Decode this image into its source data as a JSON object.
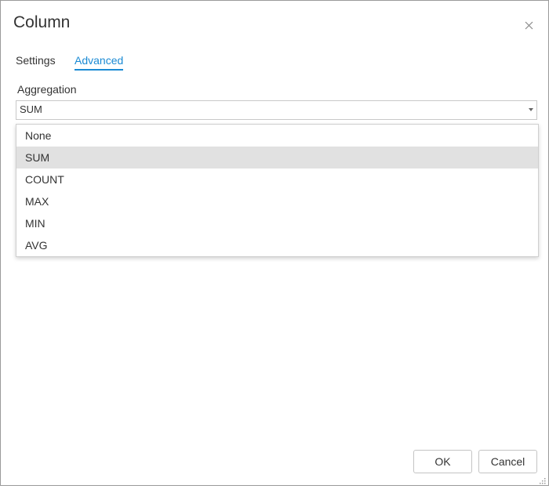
{
  "dialog": {
    "title": "Column",
    "close_icon": "close-icon"
  },
  "tabs": [
    {
      "label": "Settings",
      "active": false
    },
    {
      "label": "Advanced",
      "active": true
    }
  ],
  "aggregation": {
    "label": "Aggregation",
    "value": "SUM",
    "options": [
      "None",
      "SUM",
      "COUNT",
      "MAX",
      "MIN",
      "AVG"
    ],
    "highlighted": "SUM"
  },
  "footer": {
    "ok_label": "OK",
    "cancel_label": "Cancel"
  },
  "colors": {
    "accent": "#1a8ad4",
    "highlight": "#e1e1e1"
  }
}
